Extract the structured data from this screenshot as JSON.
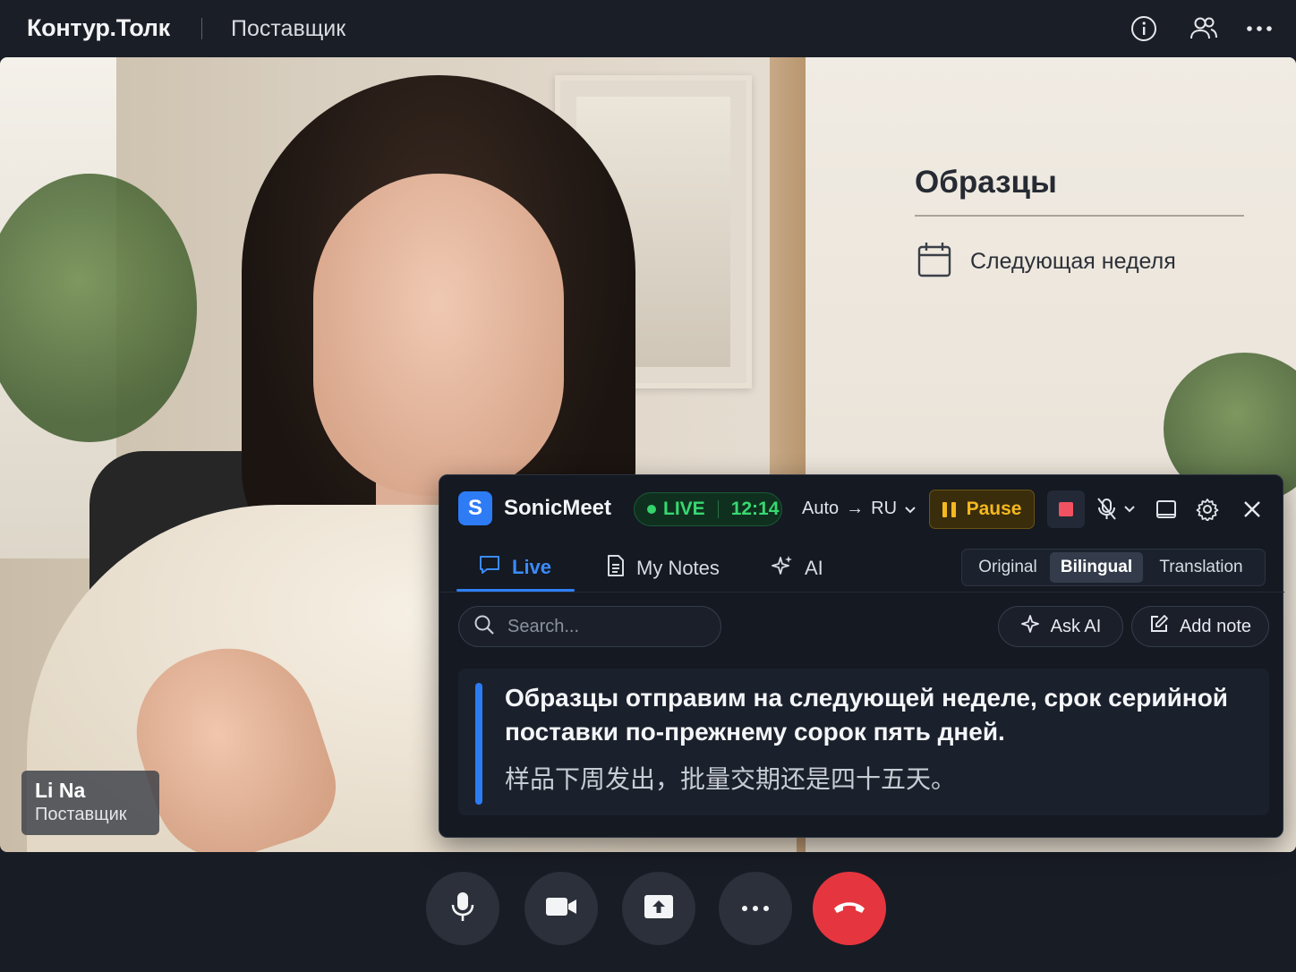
{
  "header": {
    "app_name": "Контур.Толк",
    "meeting_title": "Поставщик",
    "icons": [
      "info-icon",
      "participants-icon",
      "more-icon"
    ]
  },
  "slide": {
    "title": "Образцы",
    "item": "Следующая неделя",
    "item_icon": "calendar-icon"
  },
  "participant": {
    "name": "Li Na",
    "role": "Поставщик"
  },
  "sonicmeet": {
    "logo_letter": "S",
    "brand": "SonicMeet",
    "status": "LIVE",
    "elapsed": "12:14",
    "lang_source": "Auto",
    "lang_arrow": "→",
    "lang_target": "RU",
    "pause_label": "Pause",
    "tabs": [
      {
        "label": "Live",
        "icon": "chat-bubble-icon"
      },
      {
        "label": "My Notes",
        "icon": "document-icon"
      },
      {
        "label": "AI",
        "icon": "sparkle-icon"
      }
    ],
    "view_modes": [
      {
        "label": "Original"
      },
      {
        "label": "Bilingual"
      },
      {
        "label": "Translation"
      }
    ],
    "active_view": "Bilingual",
    "search_placeholder": "Search...",
    "ask_ai_label": "Ask AI",
    "add_note_label": "Add note",
    "transcript": {
      "translation": "Образцы отправим на следующей неделе, срок серийной поставки по-прежнему сорок пять дней.",
      "original": "样品下周发出，批量交期还是四十五天。"
    }
  },
  "colors": {
    "accent": "#2f7ff5",
    "live": "#38d870",
    "pause": "#f5b81f",
    "stop": "#f05262",
    "end_call": "#e5363f"
  },
  "controls": [
    "microphone-icon",
    "camera-icon",
    "share-screen-icon",
    "more-icon",
    "end-call-icon"
  ]
}
